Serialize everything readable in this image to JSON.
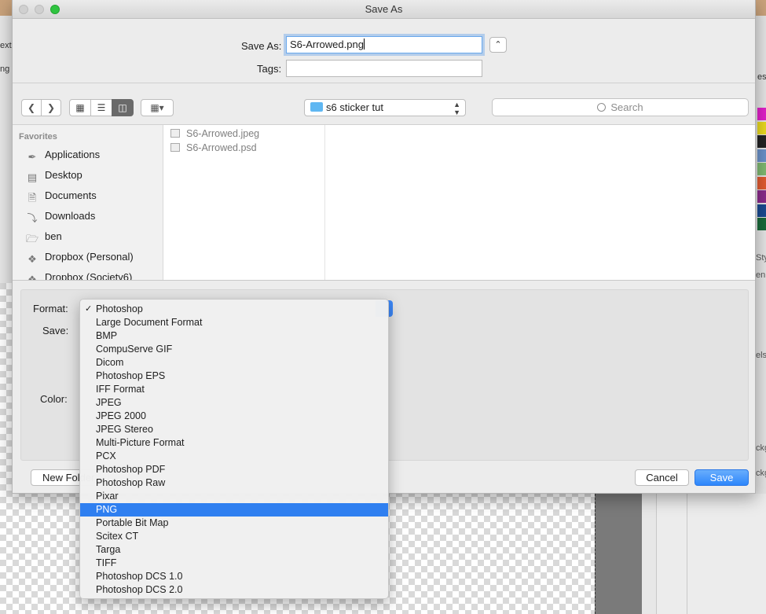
{
  "background": {
    "left_texts": [
      "ext",
      "ng @"
    ],
    "right_texts": [
      "es",
      "Sty",
      "en",
      "els",
      "ckg",
      "ckg"
    ],
    "swatch_colors": [
      "#e020c8",
      "#e8d820",
      "#222222",
      "#6a90c8",
      "#7fb870",
      "#e05a30",
      "#8a2a8a",
      "#1a4a90",
      "#1a6a3a"
    ]
  },
  "dialog": {
    "title": "Save As",
    "save_as_label": "Save As:",
    "filename": "S6-Arrowed.png",
    "tags_label": "Tags:",
    "tags_value": "",
    "expand_icon": "chevron-up-icon",
    "toolbar": {
      "location": "s6 sticker tut",
      "search_placeholder": "Search"
    },
    "sidebar": {
      "header": "Favorites",
      "items": [
        {
          "label": "Applications",
          "icon": "applications-icon"
        },
        {
          "label": "Desktop",
          "icon": "desktop-icon"
        },
        {
          "label": "Documents",
          "icon": "documents-icon"
        },
        {
          "label": "Downloads",
          "icon": "downloads-icon"
        },
        {
          "label": "ben",
          "icon": "folder-icon"
        },
        {
          "label": "Dropbox (Personal)",
          "icon": "dropbox-icon"
        },
        {
          "label": "Dropbox (Society6)",
          "icon": "dropbox-icon"
        }
      ]
    },
    "files": [
      "S6-Arrowed.jpeg",
      "S6-Arrowed.psd"
    ],
    "options": {
      "format_label": "Format:",
      "save_label": "Save:",
      "color_label": "Color:"
    },
    "buttons": {
      "new_folder": "New Folder",
      "cancel": "Cancel",
      "save": "Save"
    }
  },
  "format_menu": {
    "checked": "Photoshop",
    "selected": "PNG",
    "items": [
      "Photoshop",
      "Large Document Format",
      "BMP",
      "CompuServe GIF",
      "Dicom",
      "Photoshop EPS",
      "IFF Format",
      "JPEG",
      "JPEG 2000",
      "JPEG Stereo",
      "Multi-Picture Format",
      "PCX",
      "Photoshop PDF",
      "Photoshop Raw",
      "Pixar",
      "PNG",
      "Portable Bit Map",
      "Scitex CT",
      "Targa",
      "TIFF",
      "Photoshop DCS 1.0",
      "Photoshop DCS 2.0"
    ]
  }
}
